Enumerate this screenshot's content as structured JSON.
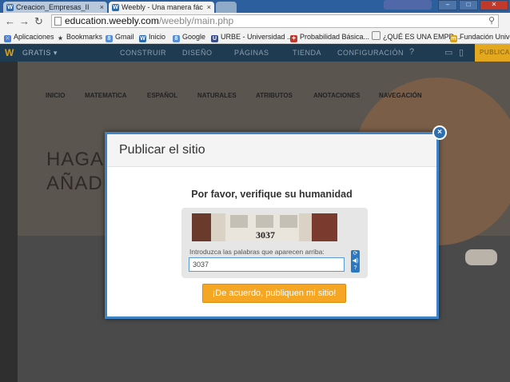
{
  "browser": {
    "tabs": [
      {
        "label": "Creacion_Empresas_II",
        "close": "×"
      },
      {
        "label": "Weebly - Una manera fác",
        "close": "×"
      }
    ],
    "url_host": "education.weebly.com",
    "url_path": "/weebly/main.php",
    "bookmarks": [
      "Aplicaciones",
      "Bookmarks",
      "Gmail",
      "Inicio",
      "Google",
      "URBE - Universidad ...",
      "Probabilidad Básica...",
      "¿QUÉ ES UNA EMPR...",
      "Fundación Univer"
    ]
  },
  "editor": {
    "logo": "W",
    "plan": "GRATIS ▾",
    "nav": [
      "CONSTRUIR",
      "DISEÑO",
      "PÁGINAS",
      "TIENDA",
      "CONFIGURACIÓN"
    ],
    "publish": "PUBLICAR"
  },
  "site": {
    "nav": [
      "INICIO",
      "MATEMATICA",
      "ESPAÑOL",
      "NATURALES",
      "ATRIBUTOS",
      "ANOTACIONES",
      "NAVEGACIÓN"
    ],
    "hero_line1": "HAGA C",
    "hero_line2": "AÑADI"
  },
  "modal": {
    "title": "Publicar el sitio",
    "close": "×",
    "heading": "Por favor, verifique su humanidad",
    "captcha_number": "3037",
    "captcha_label": "Introduzca las palabras que aparecen arriba:",
    "captcha_value": "3037",
    "captcha_buttons": [
      "⟳",
      "◀)",
      "?"
    ],
    "publish_button": "¡De acuerdo, publiquen mi sitio!"
  }
}
